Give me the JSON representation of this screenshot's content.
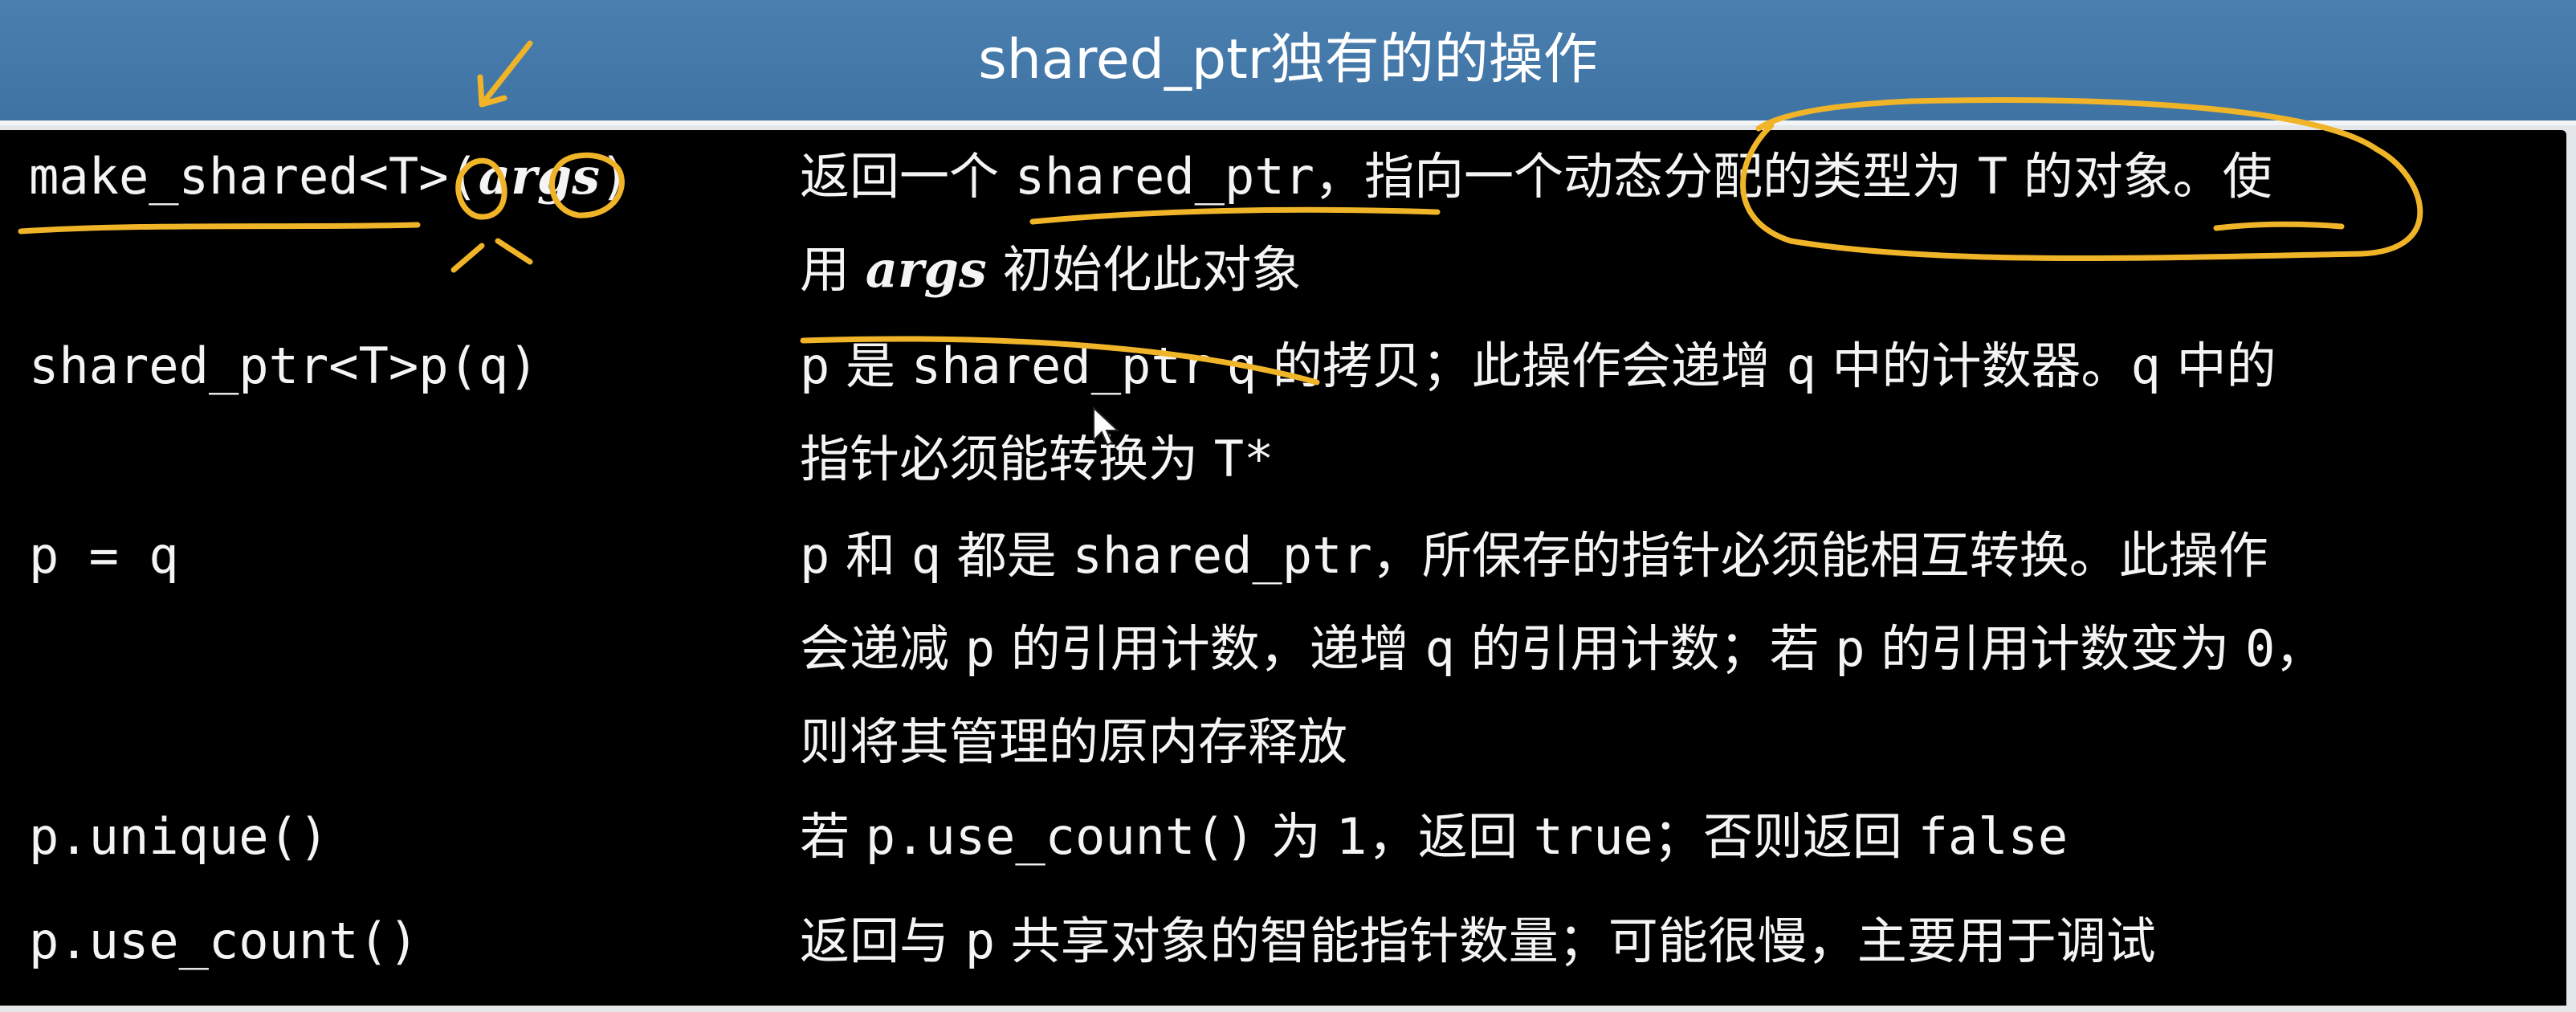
{
  "title": "shared_ptr独有的的操作",
  "rows": [
    {
      "op": {
        "pre": "make_shared<T>(",
        "arg": "args",
        "post": ")"
      },
      "desc": [
        [
          {
            "t": "返回一个 "
          },
          {
            "t": "shared_ptr",
            "m": true
          },
          {
            "t": "，指向一个动态分配的类型为 "
          },
          {
            "t": "T",
            "m": true
          },
          {
            "t": " 的对象。使"
          }
        ],
        [
          {
            "t": "用 "
          },
          {
            "t": "args",
            "i": true
          },
          {
            "t": " 初始化此对象"
          }
        ]
      ]
    },
    {
      "op": {
        "pre": "shared_ptr<T>p(q)"
      },
      "desc": [
        [
          {
            "t": "p",
            "m": true
          },
          {
            "t": " 是 "
          },
          {
            "t": "shared_ptr",
            "m": true
          },
          {
            "t": " "
          },
          {
            "t": "q",
            "m": true
          },
          {
            "t": " 的拷贝；此操作会递增 "
          },
          {
            "t": "q",
            "m": true
          },
          {
            "t": " 中的计数器。"
          },
          {
            "t": "q",
            "m": true
          },
          {
            "t": " 中的"
          }
        ],
        [
          {
            "t": "指针必须能转换为 "
          },
          {
            "t": "T*",
            "m": true
          }
        ]
      ]
    },
    {
      "op": {
        "pre": "p = q"
      },
      "desc": [
        [
          {
            "t": "p",
            "m": true
          },
          {
            "t": " 和 "
          },
          {
            "t": "q",
            "m": true
          },
          {
            "t": " 都是 "
          },
          {
            "t": "shared_ptr",
            "m": true
          },
          {
            "t": "，所保存的指针必须能相互转换。此操作"
          }
        ],
        [
          {
            "t": "会递减 "
          },
          {
            "t": "p",
            "m": true
          },
          {
            "t": " 的引用计数，递增 "
          },
          {
            "t": "q",
            "m": true
          },
          {
            "t": " 的引用计数；若 "
          },
          {
            "t": "p",
            "m": true
          },
          {
            "t": " 的引用计数变为 "
          },
          {
            "t": "0",
            "m": true
          },
          {
            "t": "，"
          }
        ],
        [
          {
            "t": "则将其管理的原内存释放"
          }
        ]
      ]
    },
    {
      "op": {
        "pre": "p.unique()"
      },
      "desc": [
        [
          {
            "t": "若 "
          },
          {
            "t": "p.use_count()",
            "m": true
          },
          {
            "t": " 为 1，返回 "
          },
          {
            "t": "true",
            "m": true
          },
          {
            "t": "；否则返回 "
          },
          {
            "t": "false",
            "m": true
          }
        ]
      ]
    },
    {
      "op": {
        "pre": "p.use_count()"
      },
      "desc": [
        [
          {
            "t": "返回与 "
          },
          {
            "t": "p",
            "m": true
          },
          {
            "t": " 共享对象的智能指针数量；可能很慢，主要用于调试"
          }
        ]
      ]
    }
  ]
}
